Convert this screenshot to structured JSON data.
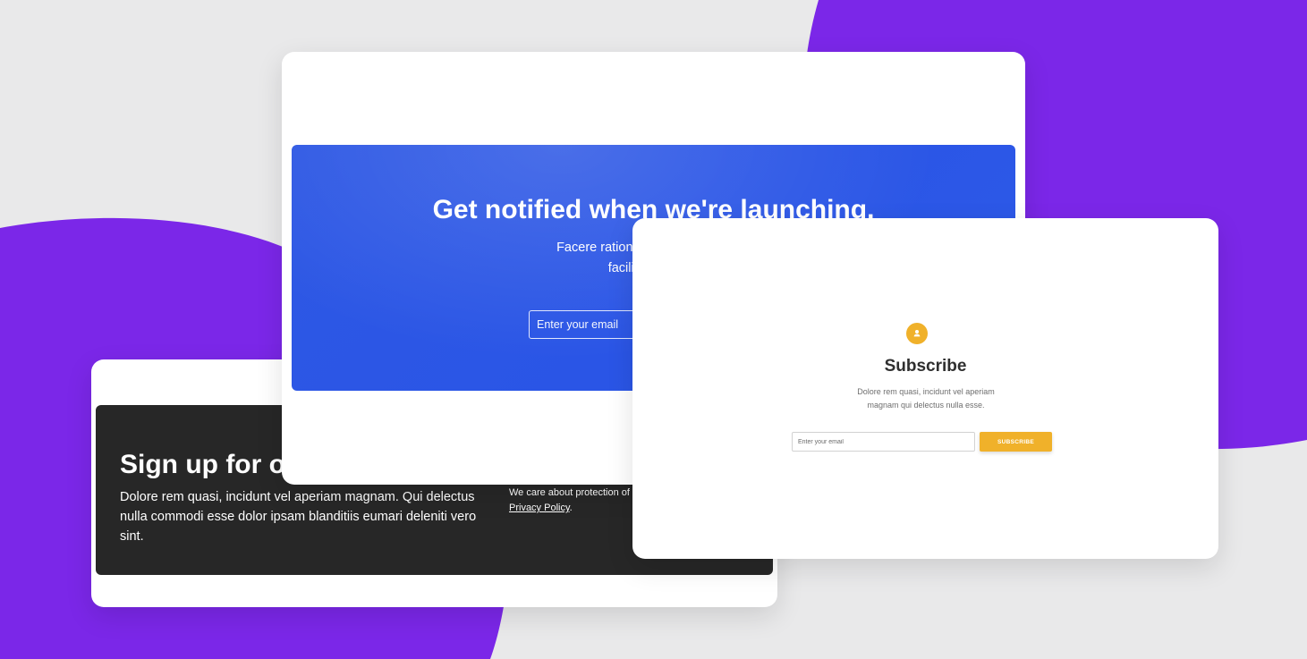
{
  "colors": {
    "background": "#e9e9ea",
    "purple_accent": "#7b27e8",
    "blue_panel": "#2a55e6",
    "dark_panel": "#272727",
    "subscribe_accent": "#f0b12a"
  },
  "dark_card": {
    "title": "Sign up for our",
    "body": "Dolore rem quasi, incidunt vel aperiam magnam. Qui delectus nulla commodi esse dolor ipsam blanditiis eumari deleniti vero sint.",
    "privacy_text": "We care about protection of y",
    "privacy_link": "Privacy Policy",
    "privacy_end": "."
  },
  "blue_card": {
    "title": "Get notified when we're launching.",
    "subtitle_line1": "Facere ratione fuga totam delectu",
    "subtitle_line2": "facilis esse quis",
    "email_placeholder": "Enter your email"
  },
  "subscribe_card": {
    "icon": "user-icon",
    "title": "Subscribe",
    "body_line1": "Dolore rem quasi, incidunt vel aperiam",
    "body_line2": "magnam qui delectus nulla esse.",
    "email_placeholder": "Enter your email",
    "button_label": "SUBSCRIBE"
  }
}
